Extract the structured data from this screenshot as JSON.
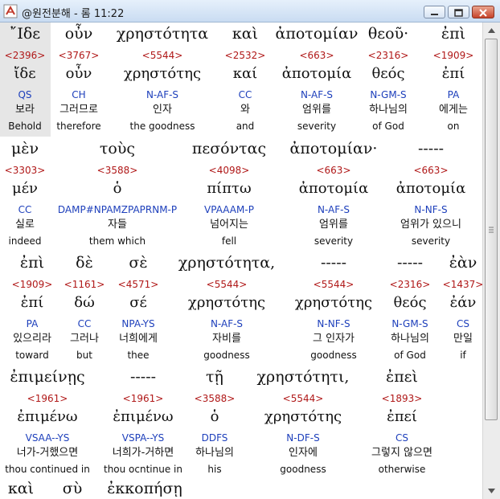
{
  "window": {
    "title": "@원전분해 - 롬 11:22",
    "title_icon": "app-icon",
    "buttons": [
      "minimize-icon",
      "maximize-icon",
      "close-icon"
    ]
  },
  "rows": [
    [
      {
        "greek": "῎Ιδε",
        "num": "<2396>",
        "lemma": "ἴδε",
        "parse": "QS",
        "korean": "보라",
        "english": "Behold",
        "highlight": true
      },
      {
        "greek": "οὖν",
        "num": "<3767>",
        "lemma": "οὖν",
        "parse": "CH",
        "korean": "그러므로",
        "english": "therefore"
      },
      {
        "greek": "χρηστότητα",
        "num": "<5544>",
        "lemma": "χρηστότης",
        "parse": "N-AF-S",
        "korean": "인자",
        "english": "the goodness"
      },
      {
        "greek": "καὶ",
        "num": "<2532>",
        "lemma": "καί",
        "parse": "CC",
        "korean": "와",
        "english": "and"
      },
      {
        "greek": "ἀποτομίαν",
        "num": "<663>",
        "lemma": "ἀποτομία",
        "parse": "N-AF-S",
        "korean": "엄위를",
        "english": "severity"
      },
      {
        "greek": "θεοῦ·",
        "num": "<2316>",
        "lemma": "θεός",
        "parse": "N-GM-S",
        "korean": "하나님의",
        "english": "of God"
      },
      {
        "greek": "ἐπὶ",
        "num": "<1909>",
        "lemma": "ἐπί",
        "parse": "PA",
        "korean": "에게는",
        "english": "on"
      }
    ],
    [
      {
        "greek": "μὲν",
        "num": "<3303>",
        "lemma": "μέν",
        "parse": "CC",
        "korean": "실로",
        "english": "indeed"
      },
      {
        "greek": "τοὺς",
        "num": "<3588>",
        "lemma": "ὁ",
        "parse": "DAMP#NPAMZPAPRNM-P",
        "korean": "자들",
        "english": "them which"
      },
      {
        "greek": "πεσόντας",
        "num": "<4098>",
        "lemma": "πίπτω",
        "parse": "VPAAAM-P",
        "korean": "넘어지는",
        "english": "fell"
      },
      {
        "greek": "ἀποτομίαν·",
        "num": "<663>",
        "lemma": "ἀποτομία",
        "parse": "N-AF-S",
        "korean": "엄위를",
        "english": "severity"
      },
      {
        "greek": "-----",
        "num": "<663>",
        "lemma": "ἀποτομία",
        "parse": "N-NF-S",
        "korean": "엄위가 있으니",
        "english": "severity"
      }
    ],
    [
      {
        "greek": "ἐπὶ",
        "num": "<1909>",
        "lemma": "ἐπί",
        "parse": "PA",
        "korean": "있으리라",
        "english": "toward"
      },
      {
        "greek": "δὲ",
        "num": "<1161>",
        "lemma": "δώ",
        "parse": "CC",
        "korean": "그러나",
        "english": "but"
      },
      {
        "greek": "σὲ",
        "num": "<4571>",
        "lemma": "σέ",
        "parse": "NPA-YS",
        "korean": "너희에게",
        "english": "thee"
      },
      {
        "greek": "χρηστότητα,",
        "num": "<5544>",
        "lemma": "χρηστότης",
        "parse": "N-AF-S",
        "korean": "자비를",
        "english": "goodness"
      },
      {
        "greek": "-----",
        "num": "<5544>",
        "lemma": "χρηστότης",
        "parse": "N-NF-S",
        "korean": "그 인자가",
        "english": "goodness"
      },
      {
        "greek": "-----",
        "num": "<2316>",
        "lemma": "θεός",
        "parse": "N-GM-S",
        "korean": "하나님의",
        "english": "of God"
      },
      {
        "greek": "ἐὰν",
        "num": "<1437>",
        "lemma": "ἐάν",
        "parse": "CS",
        "korean": "만일",
        "english": "if"
      }
    ],
    [
      {
        "greek": "ἐπιμείνῃς",
        "num": "<1961>",
        "lemma": "ἐπιμένω",
        "parse": "VSAA--YS",
        "korean": "너가-거했으면",
        "english": "thou continued in"
      },
      {
        "greek": "-----",
        "num": "<1961>",
        "lemma": "ἐπιμένω",
        "parse": "VSPA--YS",
        "korean": "너희가-거하면",
        "english": "thou ocntinue in"
      },
      {
        "greek": "τῇ",
        "num": "<3588>",
        "lemma": "ὁ",
        "parse": "DDFS",
        "korean": "하나님의",
        "english": "his"
      },
      {
        "greek": "χρηστότητι,",
        "num": "<5544>",
        "lemma": "χρηστότης",
        "parse": "N-DF-S",
        "korean": "인자에",
        "english": "goodness"
      },
      {
        "greek": "ἐπεὶ",
        "num": "<1893>",
        "lemma": "ἐπεί",
        "parse": "CS",
        "korean": "그렇지 않으면",
        "english": "otherwise"
      }
    ],
    [
      {
        "greek": "καὶ"
      },
      {
        "greek": "σὺ"
      },
      {
        "greek": "ἐκκοπήσῃ"
      }
    ]
  ]
}
